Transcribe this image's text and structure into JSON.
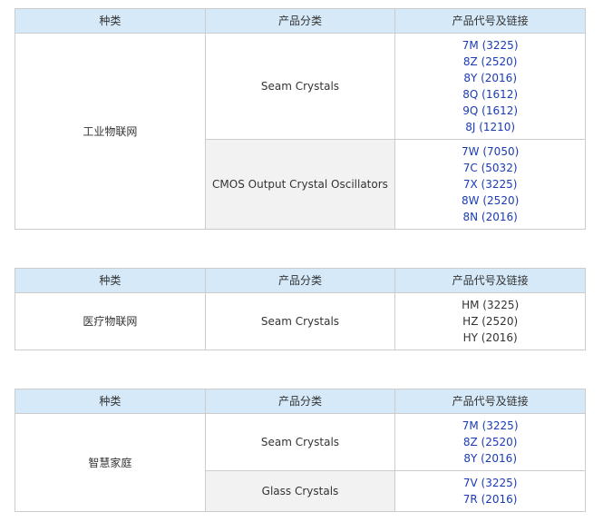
{
  "headers": [
    "种类",
    "产品分类",
    "产品代号及链接"
  ],
  "tables": [
    {
      "category": "工业物联网",
      "rows": [
        {
          "product": "Seam Crystals",
          "shaded": false,
          "codes": [
            "7M (3225)",
            "8Z (2520)",
            "8Y (2016)",
            "8Q (1612)",
            "9Q (1612)",
            "8J (1210)"
          ],
          "linked": true
        },
        {
          "product": "CMOS Output Crystal Oscillators",
          "shaded": true,
          "codes": [
            "7W (7050)",
            "7C (5032)",
            "7X (3225)",
            "8W (2520)",
            "8N (2016)"
          ],
          "linked": true
        }
      ]
    },
    {
      "category": "医疗物联网",
      "rows": [
        {
          "product": "Seam Crystals",
          "shaded": false,
          "codes": [
            "HM (3225)",
            "HZ (2520)",
            "HY (2016)"
          ],
          "linked": false
        }
      ]
    },
    {
      "category": "智慧家庭",
      "rows": [
        {
          "product": "Seam Crystals",
          "shaded": false,
          "codes": [
            "7M (3225)",
            "8Z (2520)",
            "8Y (2016)"
          ],
          "linked": true
        },
        {
          "product": "Glass Crystals",
          "shaded": true,
          "codes": [
            "7V (3225)",
            "7R (2016)"
          ],
          "linked": true
        }
      ]
    }
  ],
  "colors": {
    "header_bg": "#d6e9f8",
    "link": "#1a3bb5",
    "border": "#cccccc",
    "shaded_row": "#f2f2f2"
  }
}
